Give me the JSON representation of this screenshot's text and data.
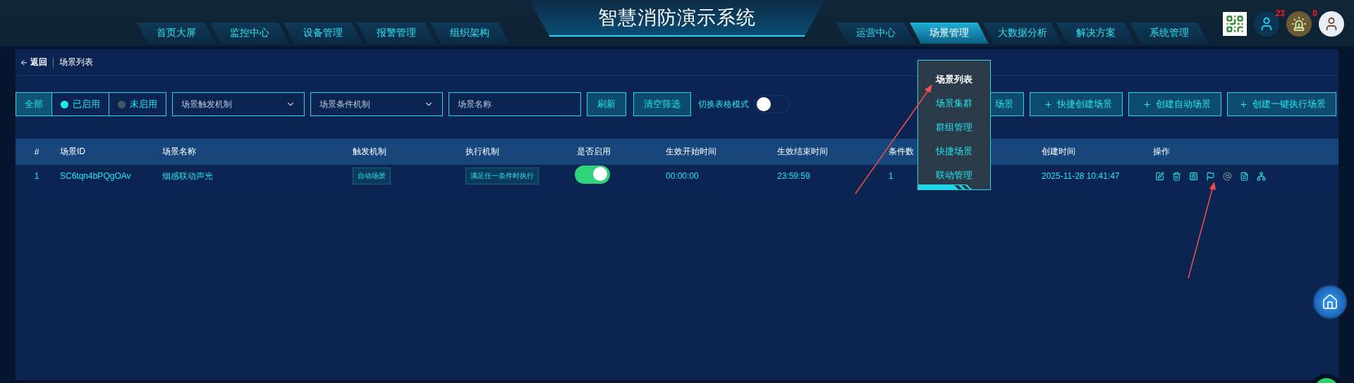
{
  "header": {
    "title": "智慧消防演示系统",
    "nav_left": [
      {
        "label": "首页大屏",
        "selected": false
      },
      {
        "label": "监控中心",
        "selected": false
      },
      {
        "label": "设备管理",
        "selected": false
      },
      {
        "label": "报警管理",
        "selected": false
      },
      {
        "label": "组织架构",
        "selected": false
      }
    ],
    "nav_right": [
      {
        "label": "运营中心",
        "selected": false
      },
      {
        "label": "场景管理",
        "selected": true
      },
      {
        "label": "大数据分析",
        "selected": false
      },
      {
        "label": "解决方案",
        "selected": false
      },
      {
        "label": "系统管理",
        "selected": false
      }
    ],
    "user_badge": "23",
    "alarm_badge": "0"
  },
  "breadcrumb": {
    "back": "返回",
    "current": "场景列表"
  },
  "filters": {
    "status": [
      {
        "label": "全部",
        "selected": true
      },
      {
        "label": "已启用",
        "selected": false,
        "color": "#22e6f0"
      },
      {
        "label": "未启用",
        "selected": false,
        "color": "#4a5562"
      }
    ],
    "trigger_select": {
      "placeholder": "场景触发机制"
    },
    "condition_select": {
      "placeholder": "场景条件机制"
    },
    "name_field": {
      "placeholder": "场景名称"
    },
    "refresh": "刷新",
    "clear": "清空筛选",
    "table_mode_label": "切换表格模式",
    "table_mode_on": false
  },
  "create_buttons": [
    {
      "label": "场景"
    },
    {
      "label": "快捷创建场景",
      "plus": true
    },
    {
      "label": "创建自动场景",
      "plus": true
    },
    {
      "label": "创建一键执行场景",
      "plus": true
    }
  ],
  "table": {
    "columns": [
      "#",
      "场景ID",
      "场景名称",
      "触发机制",
      "执行机制",
      "是否启用",
      "生效开始时间",
      "生效结束时间",
      "条件数",
      "创建时间",
      "操作"
    ],
    "rows": [
      {
        "index": "1",
        "id": "SC6tqn4bPQgOAv",
        "name": "烟感联动声光",
        "trigger": "自动场景",
        "execution": "满足任一条件时执行",
        "enabled": true,
        "start": "00:00:00",
        "end": "23:59:59",
        "conditions": "1",
        "created": "2025-11-28 10:41:47",
        "actions": [
          {
            "disabled": false
          },
          {
            "disabled": false
          },
          {
            "disabled": false
          },
          {
            "disabled": false
          },
          {
            "disabled": true
          },
          {
            "disabled": false
          },
          {
            "disabled": false
          }
        ]
      }
    ]
  },
  "dropdown_menu": [
    {
      "label": "场景列表",
      "selected": true
    },
    {
      "label": "场景集群",
      "selected": false
    },
    {
      "label": "群组管理",
      "selected": false
    },
    {
      "label": "快捷场景",
      "selected": false
    },
    {
      "label": "联动管理",
      "selected": false
    }
  ]
}
